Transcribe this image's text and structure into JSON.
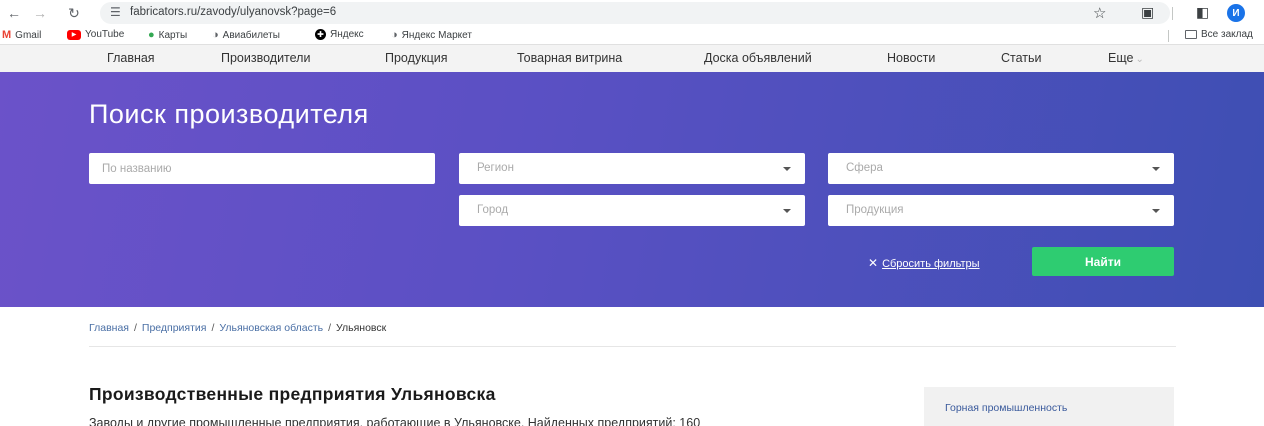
{
  "browser": {
    "url": "fabricators.ru/zavody/ulyanovsk?page=6",
    "profile_initial": "И",
    "bookmarks": [
      {
        "label": "Gmail",
        "icon": "gmail-icon"
      },
      {
        "label": "YouTube",
        "icon": "youtube-icon"
      },
      {
        "label": "Карты",
        "icon": "maps-icon"
      },
      {
        "label": "Авиабилеты",
        "icon": "globe-icon"
      },
      {
        "label": "Яндекс",
        "icon": "yandex-icon"
      },
      {
        "label": "Яндекс Маркет",
        "icon": "globe-icon"
      }
    ],
    "all_bookmarks_label": "Все заклад"
  },
  "sitenav": {
    "items": [
      "Главная",
      "Производители",
      "Продукция",
      "Товарная витрина",
      "Доска объявлений",
      "Новости",
      "Статьи",
      "Еще"
    ]
  },
  "search": {
    "title": "Поиск производителя",
    "name_placeholder": "По названию",
    "region_placeholder": "Регион",
    "sphere_placeholder": "Сфера",
    "city_placeholder": "Город",
    "products_placeholder": "Продукция",
    "reset_label": "Сбросить фильтры",
    "find_label": "Найти"
  },
  "breadcrumb": [
    "Главная",
    "Предприятия",
    "Ульяновская область",
    "Ульяновск"
  ],
  "content": {
    "title": "Производственные предприятия Ульяновска",
    "description": "Заводы и другие промышленные предприятия, работающие в Ульяновске. Найденных предприятий: 160"
  },
  "sidebar": {
    "categories": [
      "Горная промышленность"
    ]
  },
  "colors": {
    "hero_start": "#6b52c9",
    "hero_end": "#3e4fb3",
    "find_button": "#2ecc71",
    "link": "#4a6fa5"
  }
}
